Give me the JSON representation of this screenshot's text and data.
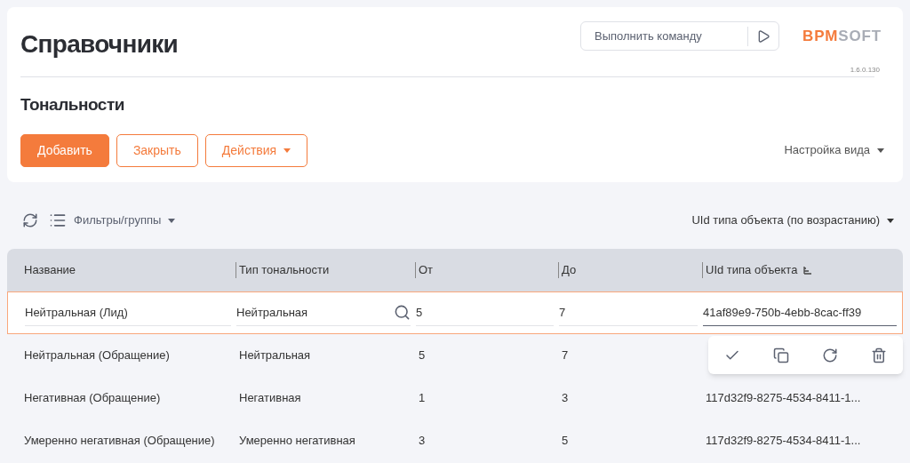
{
  "header": {
    "title": "Справочники",
    "command": {
      "placeholder": "Выполнить команду"
    },
    "logo": {
      "part_1": "BPM",
      "part_2": "SOFT"
    },
    "version": "1.6.0.130"
  },
  "section": {
    "title": "Тональности",
    "buttons": [
      {
        "label": "Добавить",
        "kind": "primary"
      },
      {
        "label": "Закрыть",
        "kind": "outline"
      },
      {
        "label": "Действия",
        "kind": "dropdown"
      }
    ],
    "view_settings": "Настройка вида"
  },
  "toolbar": {
    "filters": "Фильтры/группы",
    "sort": "UId типа объекта (по возрастанию)"
  },
  "table": {
    "columns": [
      {
        "label": "Название",
        "sorted": false
      },
      {
        "label": "Тип тональности",
        "sorted": false
      },
      {
        "label": "От",
        "sorted": false
      },
      {
        "label": "До",
        "sorted": false
      },
      {
        "label": "UId типа объекта",
        "sorted": true
      }
    ],
    "rows": [
      {
        "selected": true,
        "cells": [
          "Нейтральная (Лид)",
          "Нейтральная",
          "5",
          "7",
          "41af89e9-750b-4ebb-8cac-ff39"
        ]
      },
      {
        "selected": false,
        "cells": [
          "Нейтральная (Обращение)",
          "Нейтральная",
          "5",
          "7"
        ]
      },
      {
        "selected": false,
        "cells": [
          "Негативная (Обращение)",
          "Негативная",
          "1",
          "3",
          "117d32f9-8275-4534-8411-1..."
        ]
      },
      {
        "selected": false,
        "cells": [
          "Умеренно негативная (Обращение)",
          "Умеренно негативная",
          "3",
          "5",
          "117d32f9-8275-4534-8411-1..."
        ]
      }
    ]
  }
}
